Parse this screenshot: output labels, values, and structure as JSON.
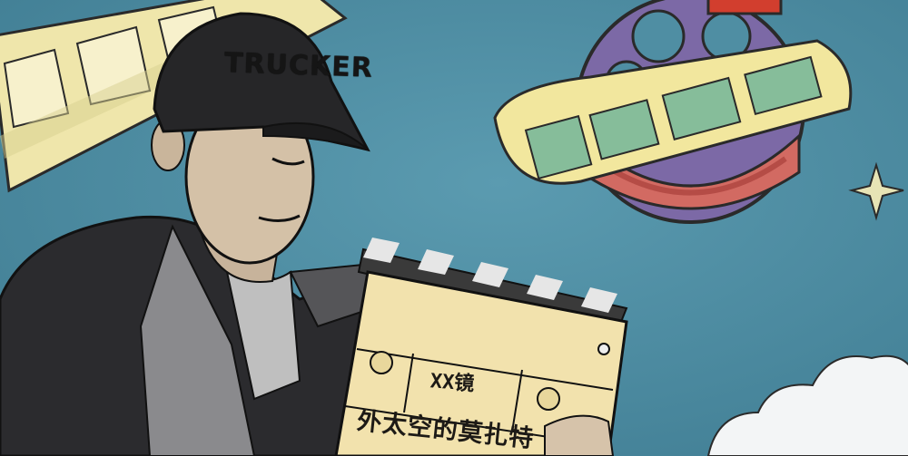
{
  "colors": {
    "sky": "#4f8ea3",
    "film": "#f0e7a1",
    "planet_purple": "#7d6aa8",
    "planet_red": "#d16b62",
    "jacket": "#2b2b2e",
    "clapper": "#f3e3b2",
    "cloud": "#f4f6f7"
  },
  "cap": {
    "brand": "TRUCKER"
  },
  "clapperboard": {
    "label": "XX镜",
    "title": "外太空的莫扎特"
  },
  "icons": [
    "planet-icon",
    "star-icon",
    "film-strip-icon",
    "clapperboard-icon"
  ]
}
